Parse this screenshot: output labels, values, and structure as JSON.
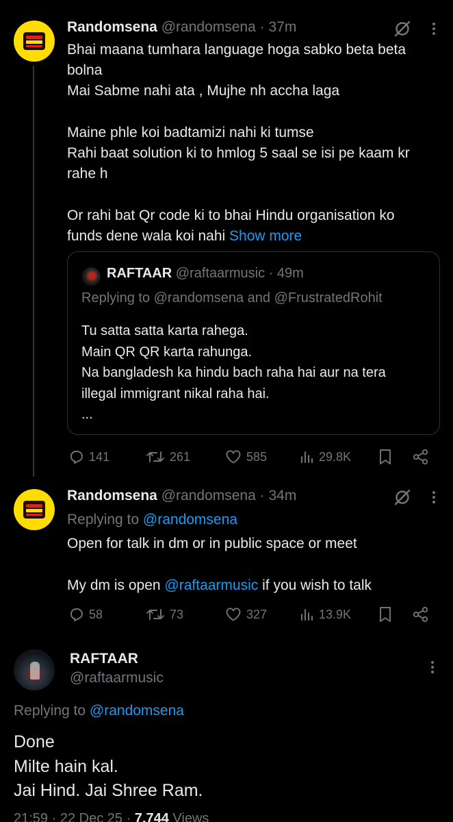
{
  "tweets": [
    {
      "name": "Randomsena",
      "handle": "@randomsena",
      "time": "37m",
      "lines": [
        "Bhai maana tumhara language hoga sabko beta beta",
        "bolna",
        "Mai Sabme nahi ata , Mujhe nh accha laga",
        "",
        "Maine phle koi badtamizi nahi ki tumse",
        "Rahi baat solution ki to hmlog 5 saal se isi pe kaam kr",
        "rahe h",
        "",
        "Or rahi bat Qr code ki to bhai Hindu organisation ko"
      ],
      "last_line": "funds dene wala koi nahi",
      "show_more": "Show more",
      "quote": {
        "name": "RAFTAAR",
        "handle": "@raftaarmusic",
        "time": "49m",
        "replying_prefix": "Replying to",
        "replying_to": "@randomsena and @FrustratedRohit",
        "lines": [
          "Tu satta satta karta rahega.",
          "Main QR QR karta rahunga.",
          "Na bangladesh ka hindu bach raha hai aur na tera",
          "illegal immigrant nikal raha hai.",
          "..."
        ]
      },
      "stats": {
        "replies": "141",
        "reposts": "261",
        "likes": "585",
        "views": "29.8K"
      }
    },
    {
      "name": "Randomsena",
      "handle": "@randomsena",
      "time": "34m",
      "replying_prefix": "Replying to",
      "replying_to": "@randomsena",
      "line1": "Open for talk in dm or in public space or meet",
      "line2_pre": "My dm is open",
      "line2_mention": "@raftaarmusic",
      "line2_post": "if you wish to talk",
      "stats": {
        "replies": "58",
        "reposts": "73",
        "likes": "327",
        "views": "13.9K"
      }
    }
  ],
  "main_tweet": {
    "name": "RAFTAAR",
    "handle": "@raftaarmusic",
    "replying_prefix": "Replying to",
    "replying_to": "@randomsena",
    "lines": [
      "Done",
      "Milte hain kal.",
      "Jai Hind. Jai Shree Ram."
    ],
    "time_date": "21:59 · 22 Dec 25 ·",
    "views": "7,744",
    "views_label": "Views"
  },
  "colors": {
    "background": "#000000",
    "text": "#e7e9ea",
    "muted": "#71767b",
    "link": "#1d9bf0",
    "avatar_yellow": "#ffdd00"
  },
  "icons": [
    "grok-slash-icon",
    "more-dots-icon",
    "reply-icon",
    "repost-icon",
    "like-icon",
    "views-icon",
    "bookmark-icon",
    "share-icon"
  ]
}
